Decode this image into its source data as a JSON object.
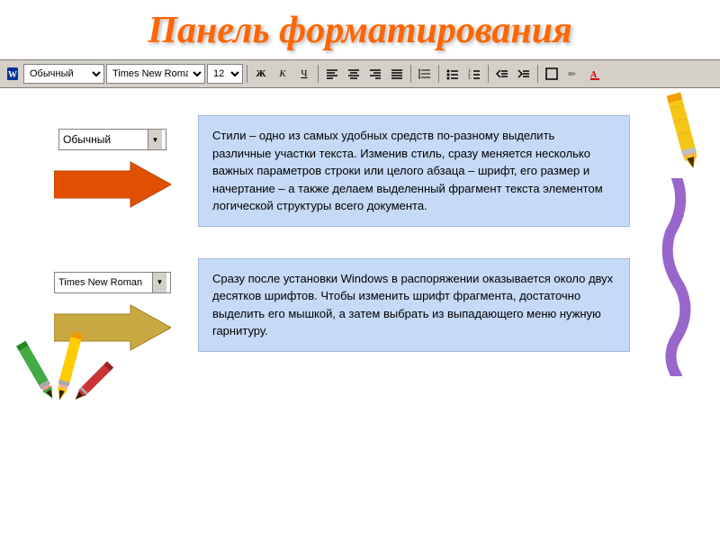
{
  "title": "Панель форматирования",
  "toolbar": {
    "style_value": "Обычный",
    "font_value": "Times New Roman",
    "size_value": "12",
    "bold_label": "Ж",
    "italic_label": "К",
    "underline_label": "Ч"
  },
  "section1": {
    "dropdown_text": "Обычный",
    "info_text": "Стили – одно из самых удобных средств по-разному выделить различные участки текста. Изменив стиль, сразу меняется несколько важных параметров строки или целого абзаца – шрифт, его размер и начертание – а также делаем выделенный фрагмент текста элементом логической структуры всего документа."
  },
  "section2": {
    "dropdown_text": "Times New Roman",
    "info_text": "Сразу после установки Windows в распоряжении оказывается около двух десятков шрифтов. Чтобы изменить шрифт фрагмента, достаточно выделить его мышкой, а затем выбрать из выпадающего меню нужную гарнитуру."
  }
}
